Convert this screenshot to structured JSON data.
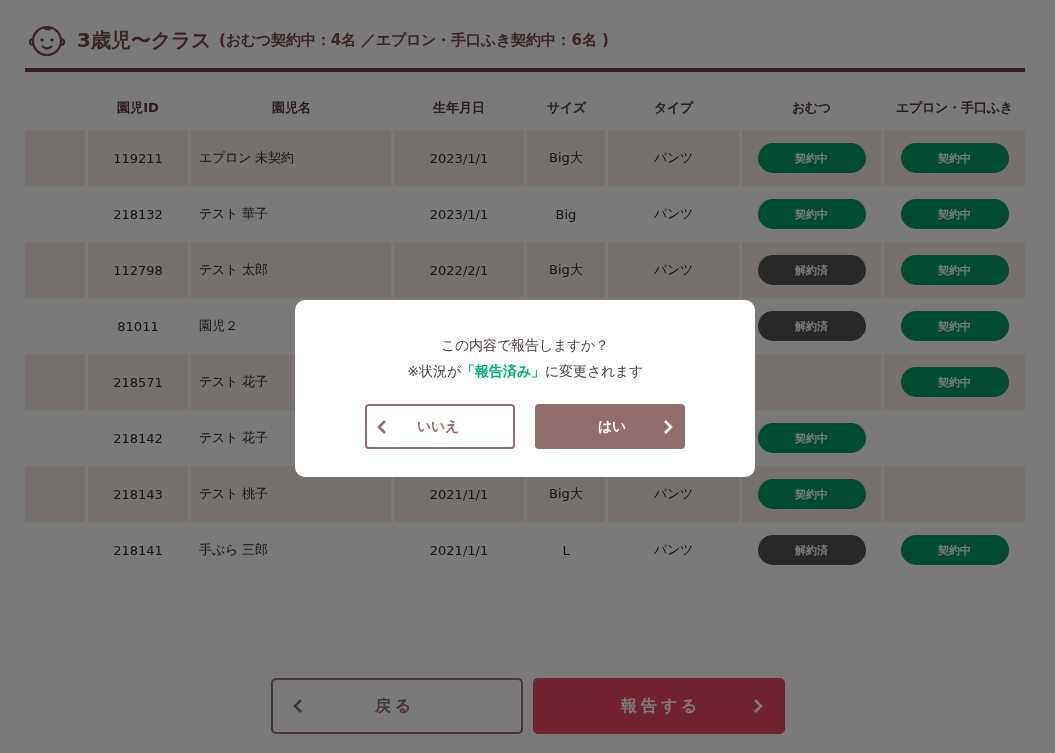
{
  "header": {
    "title": "3歳児〜クラス",
    "summary": "(おむつ契約中：4名 ／エプロン・手口ふき契約中：6名 )"
  },
  "table": {
    "columns": [
      "園児ID",
      "園児名",
      "生年月日",
      "サイズ",
      "タイプ",
      "おむつ",
      "エプロン・手口ふき"
    ],
    "rows": [
      {
        "id": "119211",
        "name": "エプロン 未契約",
        "birth": "2023/1/1",
        "size": "Big大",
        "type": "パンツ",
        "diaper": {
          "kind": "active",
          "label": "契約中"
        },
        "apron": {
          "kind": "active",
          "label": "契約中"
        }
      },
      {
        "id": "218132",
        "name": "テスト 華子",
        "birth": "2023/1/1",
        "size": "Big",
        "type": "パンツ",
        "diaper": {
          "kind": "active",
          "label": "契約中"
        },
        "apron": {
          "kind": "active",
          "label": "契約中"
        }
      },
      {
        "id": "112798",
        "name": "テスト 太郎",
        "birth": "2022/2/1",
        "size": "Big大",
        "type": "パンツ",
        "diaper": {
          "kind": "cancelled",
          "label": "解約済"
        },
        "apron": {
          "kind": "active",
          "label": "契約中"
        }
      },
      {
        "id": "81011",
        "name": "園児２",
        "diaper": {
          "kind": "cancelled",
          "label": "解約済"
        },
        "apron": {
          "kind": "active",
          "label": "契約中"
        }
      },
      {
        "id": "218571",
        "name": "テスト 花子",
        "apron": {
          "kind": "active",
          "label": "契約中"
        }
      },
      {
        "id": "218142",
        "name": "テスト 花子",
        "diaper": {
          "kind": "active",
          "label": "契約中"
        }
      },
      {
        "id": "218143",
        "name": "テスト 桃子",
        "birth": "2021/1/1",
        "size": "Big大",
        "type": "パンツ",
        "diaper": {
          "kind": "active",
          "label": "契約中"
        }
      },
      {
        "id": "218141",
        "name": "手ぶら 三郎",
        "birth": "2021/1/1",
        "size": "L",
        "type": "パンツ",
        "diaper": {
          "kind": "cancelled",
          "label": "解約済"
        },
        "apron": {
          "kind": "active",
          "label": "契約中"
        }
      }
    ]
  },
  "footer": {
    "back": "戻る",
    "submit": "報告する"
  },
  "dialog": {
    "lines": [
      "この内容で報告しますか？",
      "※状況が**「報告済み」**に変更されます"
    ],
    "no": "いいえ",
    "yes": "はい"
  }
}
